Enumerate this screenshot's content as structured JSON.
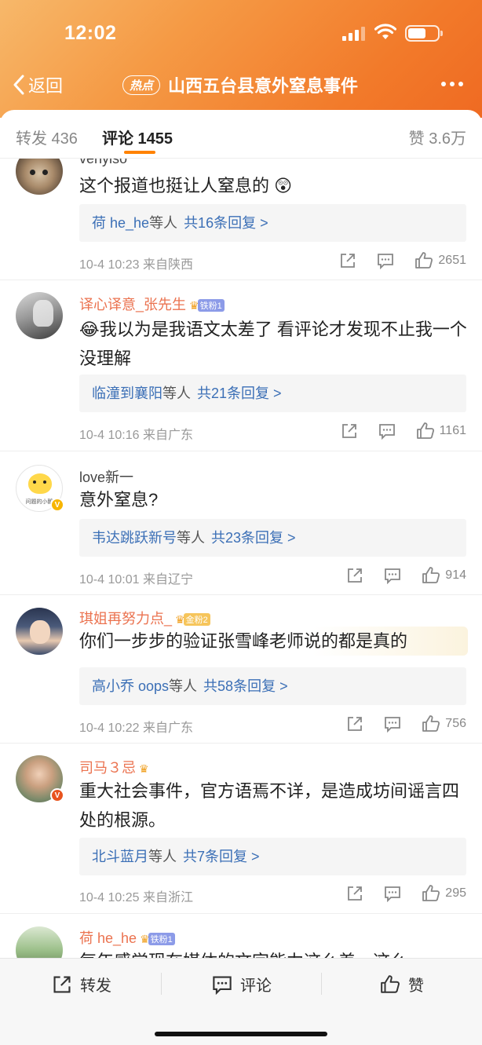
{
  "status": {
    "time": "12:02"
  },
  "nav": {
    "back_label": "返回",
    "hot_badge": "热点",
    "title": "山西五台县意外窒息事件"
  },
  "tabs": {
    "repost": "转发 436",
    "comment": "评论 1455",
    "like": "赞 3.6万"
  },
  "comments": [
    {
      "user": "venyiso",
      "text": "这个报道也挺让人窒息的 😲",
      "reply_name": "荷 he_he",
      "reply_mid": "等人",
      "reply_count": "共16条回复 >",
      "meta": "10-4 10:23  来自陕西",
      "likes": "2651"
    },
    {
      "user": "译心译意_张先生",
      "fan_badge": "铁粉1",
      "text": "😂我以为是我语文太差了 看评论才发现不止我一个没理解",
      "reply_name": "临潼到襄阳",
      "reply_mid": "等人",
      "reply_count": "共21条回复 >",
      "meta": "10-4 10:16  来自广东",
      "likes": "1161"
    },
    {
      "user": "love新一",
      "text": "意外窒息?",
      "reply_name": "韦达跳跃新号",
      "reply_mid": "等人",
      "reply_count": "共23条回复 >",
      "meta": "10-4 10:01  来自辽宁",
      "likes": "914",
      "avatar_caption": "问题的小鹅"
    },
    {
      "user": "琪姐再努力点_",
      "fan_badge": "金粉2",
      "text": "你们一步步的验证张雪峰老师说的都是真的",
      "reply_name": "高小乔 oops",
      "reply_mid": "等人",
      "reply_count": "共58条回复 >",
      "meta": "10-4 10:22  来自广东",
      "likes": "756"
    },
    {
      "user": "司马３忌",
      "text": "重大社会事件，官方语焉不详，是造成坊间谣言四处的根源。",
      "reply_name": "北斗蓝月",
      "reply_mid": "等人",
      "reply_count": "共7条回复 >",
      "meta": "10-4 10:25  来自浙江",
      "likes": "295"
    },
    {
      "user": "荷 he_he",
      "fan_badge": "铁粉1",
      "text": "每年感觉现在媒体的文字能力这么差，这么"
    }
  ],
  "bottombar": {
    "repost": "转发",
    "comment": "评论",
    "like": "赞"
  },
  "colors": {
    "accent": "#ff8200",
    "link": "#3b6fb6",
    "username": "#eb7350",
    "header": "#f27a2a"
  }
}
